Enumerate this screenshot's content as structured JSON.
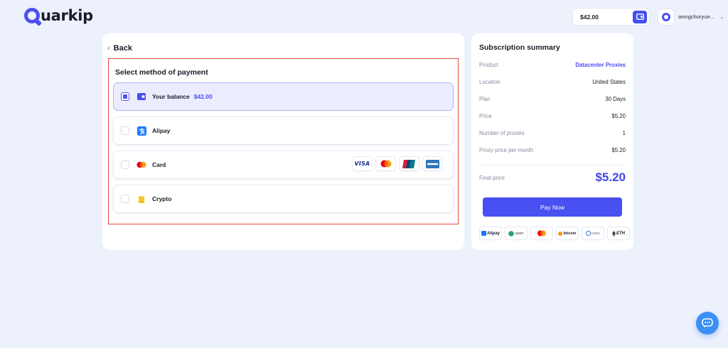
{
  "brand": {
    "name": "uarkip",
    "accent": "#4b4ff0"
  },
  "topbar": {
    "balance": "$42.00",
    "username": "wongchoryue..."
  },
  "nav": {
    "back_label": "Back"
  },
  "payment": {
    "title": "Select method of payment",
    "options": [
      {
        "label": "Your balance",
        "sub": "$42.00",
        "selected": true,
        "icon": "wallet-icon"
      },
      {
        "label": "Alipay",
        "selected": false,
        "icon": "alipay-icon"
      },
      {
        "label": "Card",
        "selected": false,
        "icon": "mastercard-icon",
        "card_brands": [
          "VISA",
          "Mastercard",
          "UnionPay",
          "American Express"
        ]
      },
      {
        "label": "Crypto",
        "selected": false,
        "icon": "coins-icon"
      }
    ]
  },
  "summary": {
    "title": "Subscription summary",
    "rows": [
      {
        "key": "Product",
        "value": "Datacenter Proxies"
      },
      {
        "key": "Location",
        "value": "United States"
      },
      {
        "key": "Plan",
        "value": "30 Days"
      },
      {
        "key": "Price",
        "value": "$5.20"
      },
      {
        "key": "Number of proxies",
        "value": "1"
      },
      {
        "key": "Proxy price per month",
        "value": "$5.20"
      }
    ],
    "final_label": "Final price",
    "final_value": "$5.20",
    "pay_label": "Pay Now",
    "pay_methods": [
      "Alipay",
      "USDT",
      "Mastercard",
      "bitcoin",
      "USDC",
      "ETH"
    ]
  },
  "colors": {
    "primary": "#4950f1",
    "highlight_border": "#e8463f",
    "chat": "#3b8ff5"
  }
}
